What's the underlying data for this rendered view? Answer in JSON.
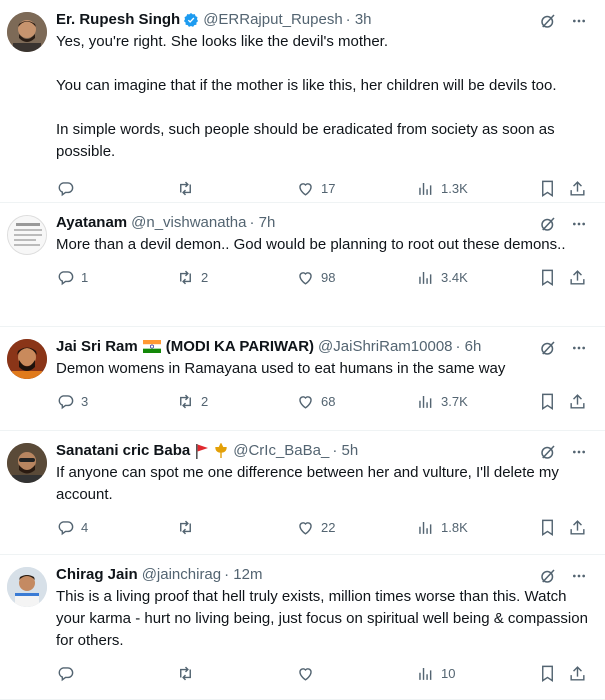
{
  "tweets": [
    {
      "name": "Er. Rupesh Singh",
      "verified": true,
      "handle": "@ERRajput_Rupesh",
      "time": "· 3h",
      "paragraphs": [
        "Yes, you're right. She looks like the devil's mother.",
        "You can imagine that if the mother is like this, her children will be devils too.",
        "In simple words, such people should be eradicated from society as soon as possible."
      ],
      "replies": "",
      "retweets": "",
      "likes": "17",
      "views": "1.3K"
    },
    {
      "name": "Ayatanam",
      "handle": "@n_vishwanatha",
      "time": "· 7h",
      "paragraphs": [
        "More than a devil demon.. God would be planning to root out these demons.."
      ],
      "replies": "1",
      "retweets": "2",
      "likes": "98",
      "views": "3.4K"
    },
    {
      "name": "Jai Sri Ram",
      "name_suffix": "(MODI KA PARIWAR)",
      "handle": "@JaiShriRam10008",
      "time": "· 6h",
      "paragraphs": [
        "Demon womens in Ramayana used to eat humans in the same way"
      ],
      "replies": "3",
      "retweets": "2",
      "likes": "68",
      "views": "3.7K"
    },
    {
      "name": "Sanatani cric Baba",
      "handle": "@CrIc_BaBa_",
      "time": "· 5h",
      "paragraphs": [
        "If anyone can spot me one difference between her and vulture, I'll delete my account."
      ],
      "replies": "4",
      "retweets": "",
      "likes": "22",
      "views": "1.8K"
    },
    {
      "name": "Chirag Jain",
      "handle": "@jainchirag",
      "time": "· 12m",
      "paragraphs": [
        "This is a living proof that hell truly exists, million times worse than this. Watch your karma - hurt no living being, just focus on spiritual well being & compassion for others."
      ],
      "replies": "",
      "retweets": "",
      "likes": "",
      "views": "10"
    }
  ],
  "colors": {
    "text": "#0f1419",
    "muted": "#536471",
    "verified": "#1d9bf0",
    "divider": "#eff3f4"
  },
  "icons": [
    "grok-icon",
    "more-icon",
    "reply-icon",
    "retweet-icon",
    "like-icon",
    "views-icon",
    "bookmark-icon",
    "share-icon",
    "verified-icon",
    "india-flag-icon",
    "red-flag-icon",
    "trishul-icon"
  ]
}
